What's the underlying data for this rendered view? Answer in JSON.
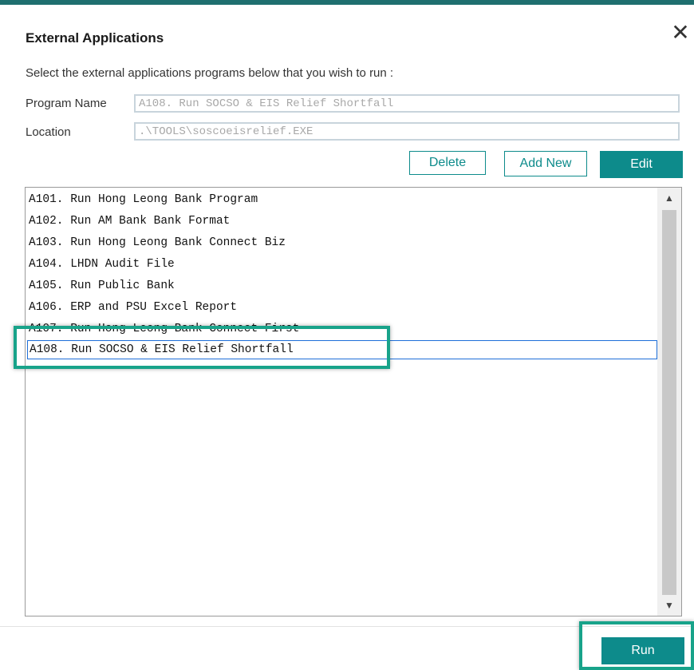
{
  "dialog": {
    "title": "External Applications",
    "instruction": "Select the external applications programs below that you wish to run :"
  },
  "form": {
    "program_name_label": "Program Name",
    "program_name_value": "A108. Run SOCSO & EIS Relief Shortfall",
    "location_label": "Location",
    "location_value": ".\\TOOLS\\soscoeisrelief.EXE"
  },
  "buttons": {
    "delete": "Delete",
    "add_new": "Add New",
    "edit": "Edit",
    "run": "Run"
  },
  "list": {
    "items": [
      "A101. Run Hong Leong Bank Program",
      "A102. Run AM Bank Bank Format",
      "A103. Run Hong Leong Bank Connect Biz",
      "A104. LHDN Audit File",
      "A105. Run Public Bank",
      "A106. ERP and PSU Excel Report",
      "A107. Run Hong Leong Bank Connect First",
      "A108. Run SOCSO & EIS Relief Shortfall"
    ],
    "selected_index": 7
  },
  "icons": {
    "close": "close-icon",
    "scroll_up": "chevron-up-icon",
    "scroll_down": "chevron-down-icon"
  },
  "colors": {
    "accent": "#0d8b8b",
    "highlight": "#18a38a",
    "top_bar": "#1f6f6f"
  }
}
